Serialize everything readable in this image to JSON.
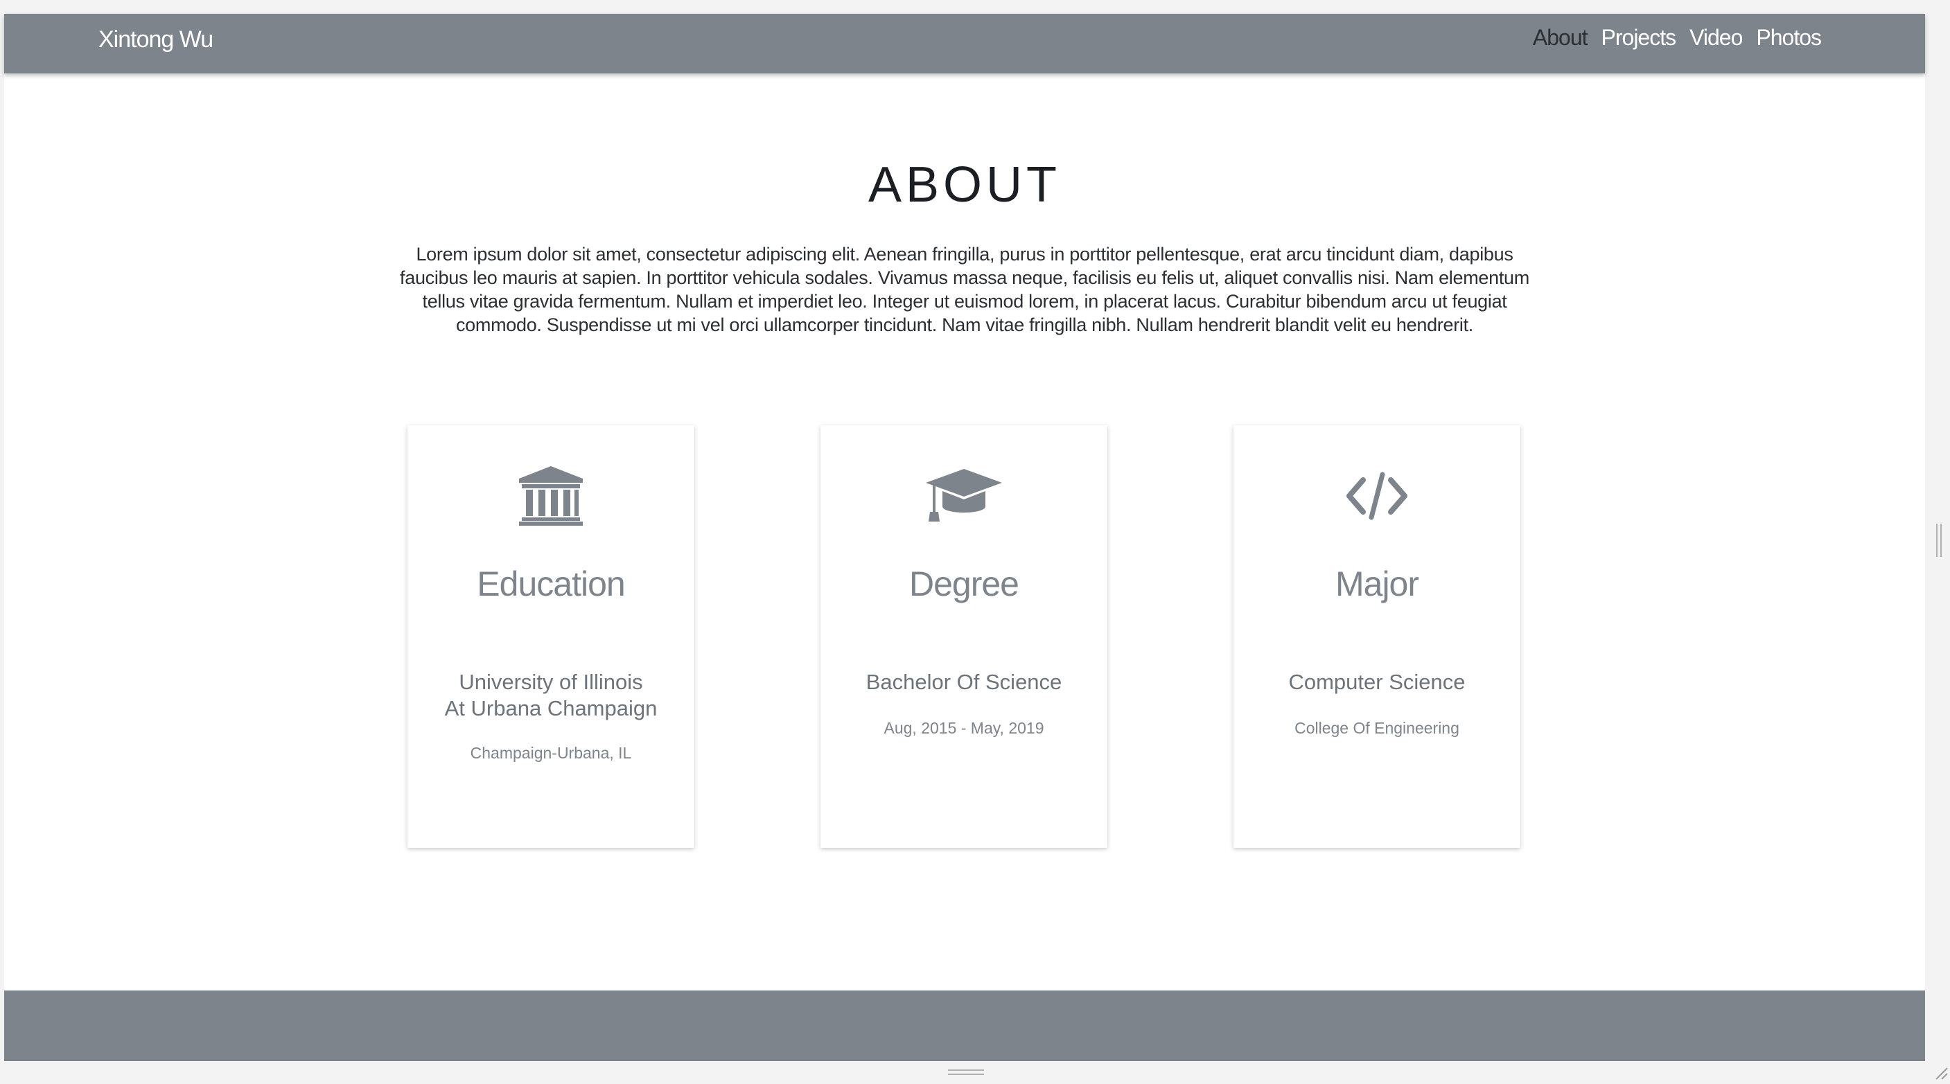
{
  "navbar": {
    "brand": "Xintong Wu",
    "links": [
      {
        "label": "About",
        "active": true
      },
      {
        "label": "Projects",
        "active": false
      },
      {
        "label": "Video",
        "active": false
      },
      {
        "label": "Photos",
        "active": false
      }
    ]
  },
  "about": {
    "title": "ABOUT",
    "intro": "Lorem ipsum dolor sit amet, consectetur adipiscing elit. Aenean fringilla, purus in porttitor pellentesque, erat arcu tincidunt diam, dapibus faucibus leo mauris at sapien. In porttitor vehicula sodales. Vivamus massa neque, facilisis eu felis ut, aliquet convallis nisi. Nam elementum tellus vitae gravida fermentum. Nullam et imperdiet leo. Integer ut euismod lorem, in placerat lacus. Curabitur bibendum arcu ut feugiat commodo. Suspendisse ut mi vel orci ullamcorper tincidunt. Nam vitae fringilla nibh. Nullam hendrerit blandit velit eu hendrerit."
  },
  "cards": [
    {
      "icon": "institution-icon",
      "heading": "Education",
      "primary_line1": "University of Illinois",
      "primary_line2": "At Urbana Champaign",
      "secondary": "Champaign-Urbana, IL"
    },
    {
      "icon": "graduation-cap-icon",
      "heading": "Degree",
      "primary_line1": "Bachelor Of Science",
      "secondary": "Aug, 2015 - May, 2019"
    },
    {
      "icon": "code-icon",
      "heading": "Major",
      "primary_line1": "Computer Science",
      "secondary": "College Of Engineering"
    }
  ],
  "colors": {
    "navbar": "#7e848b",
    "footer": "#7e848b",
    "icon": "#7e848b",
    "active_link": "#2b2e33"
  }
}
